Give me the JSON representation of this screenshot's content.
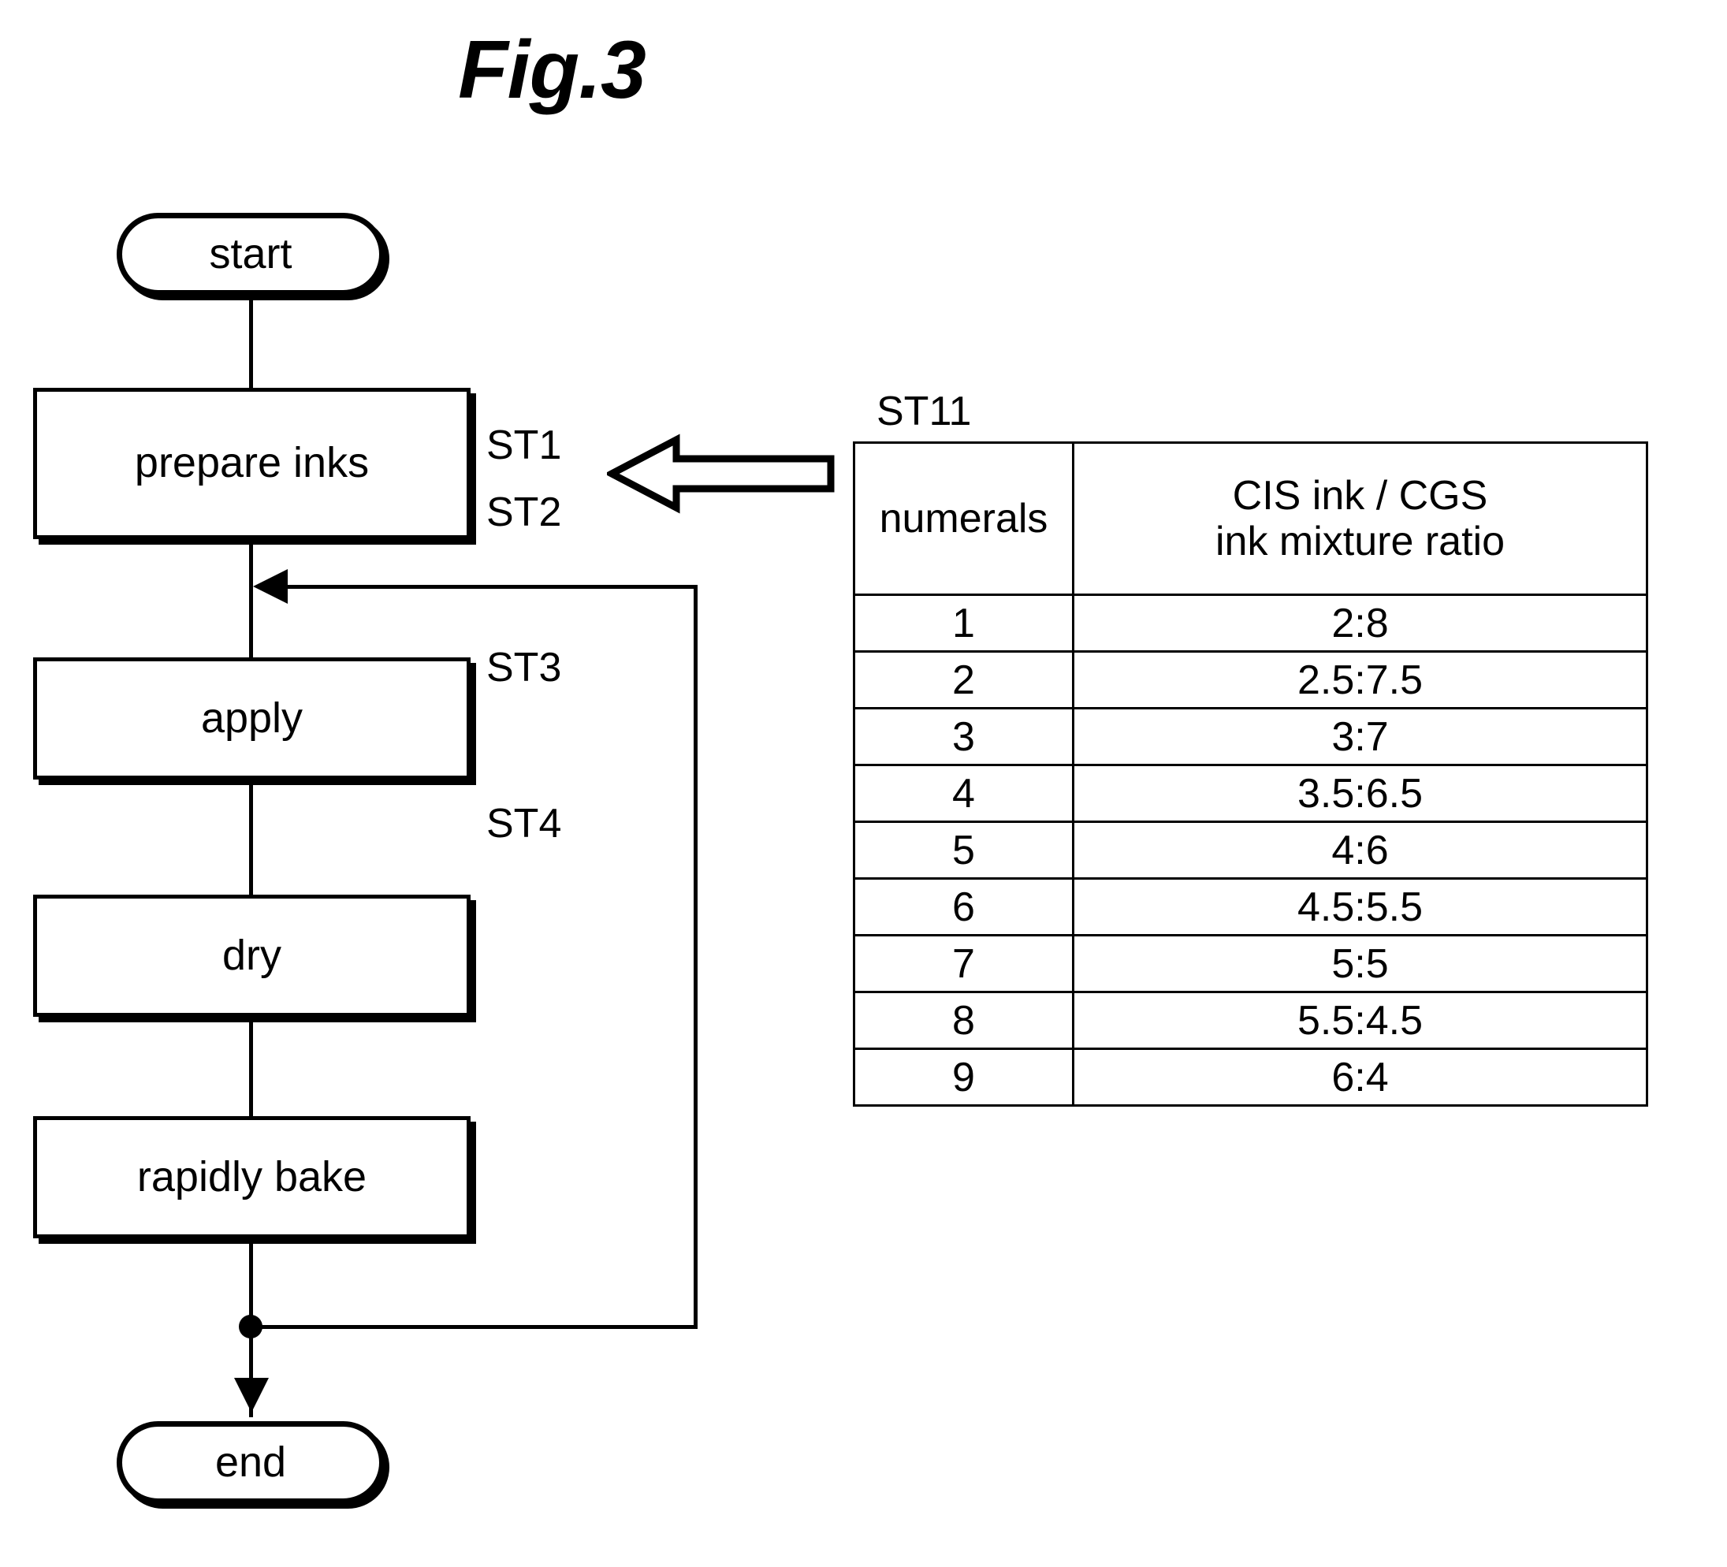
{
  "figure": {
    "title": "Fig.3"
  },
  "flowchart": {
    "nodes": [
      {
        "id": "start",
        "label": "start",
        "step": ""
      },
      {
        "id": "prepare_inks",
        "label": "prepare inks",
        "step": "ST1"
      },
      {
        "id": "apply",
        "label": "apply",
        "step": "ST2"
      },
      {
        "id": "dry",
        "label": "dry",
        "step": "ST3"
      },
      {
        "id": "rapidly_bake",
        "label": "rapidly bake",
        "step": "ST4"
      },
      {
        "id": "end",
        "label": "end",
        "step": ""
      }
    ]
  },
  "callout": {
    "arrow_direction": "left"
  },
  "table": {
    "label": "ST11",
    "headers": [
      "numerals",
      "CIS ink / CGS\nink mixture ratio"
    ],
    "header_line1": "CIS ink / CGS",
    "header_line2": "ink mixture ratio",
    "header_numerals": "numerals",
    "rows": [
      {
        "numeral": "1",
        "ratio": "2:8"
      },
      {
        "numeral": "2",
        "ratio": "2.5:7.5"
      },
      {
        "numeral": "3",
        "ratio": "3:7"
      },
      {
        "numeral": "4",
        "ratio": "3.5:6.5"
      },
      {
        "numeral": "5",
        "ratio": "4:6"
      },
      {
        "numeral": "6",
        "ratio": "4.5:5.5"
      },
      {
        "numeral": "7",
        "ratio": "5:5"
      },
      {
        "numeral": "8",
        "ratio": "5.5:4.5"
      },
      {
        "numeral": "9",
        "ratio": "6:4"
      }
    ]
  },
  "colors": {
    "ink": "#000000",
    "paper": "#ffffff"
  }
}
